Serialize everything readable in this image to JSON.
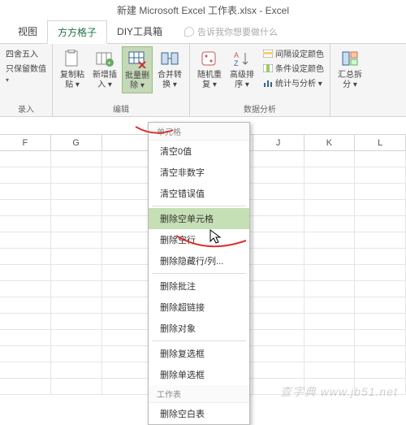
{
  "title": "新建 Microsoft Excel 工作表.xlsx - Excel",
  "tabs": {
    "t1": "视图",
    "t2": "方方格子",
    "t3": "DIY工具箱"
  },
  "tellme": "告诉我你想要做什么",
  "ribbon": {
    "left": {
      "l1": "四舍五入",
      "l2": "只保留数值",
      "glabel": "录入"
    },
    "edit": {
      "copy": "复制粘\n贴 ▾",
      "insert": "新增插\n入 ▾",
      "batchdel": "批量删\n除 ▾",
      "merge": "合并转\n换 ▾",
      "glabel": "编辑"
    },
    "data": {
      "random": "随机重\n复 ▾",
      "sort": "高级排\n序 ▾",
      "s1": "间隔设定颜色",
      "s2": "条件设定颜色",
      "s3": "统计与分析 ▾",
      "glabel": "数据分析"
    },
    "right": {
      "sum": "汇总拆\n分 ▾"
    }
  },
  "menu": {
    "sec1": "单元格",
    "m1": "清空0值",
    "m2": "清空非数字",
    "m3": "清空错误值",
    "m4": "删除空单元格",
    "m5": "删除空行",
    "m6": "删除隐藏行/列...",
    "m7": "删除批注",
    "m8": "删除超链接",
    "m9": "删除对象",
    "m10": "删除复选框",
    "m11": "删除单选框",
    "sec2": "工作表",
    "m12": "删除空白表"
  },
  "cols": {
    "c1": "F",
    "c2": "G",
    "c3": "J",
    "c4": "K",
    "c5": "L"
  },
  "watermark": "查字典 www.jb51.net"
}
